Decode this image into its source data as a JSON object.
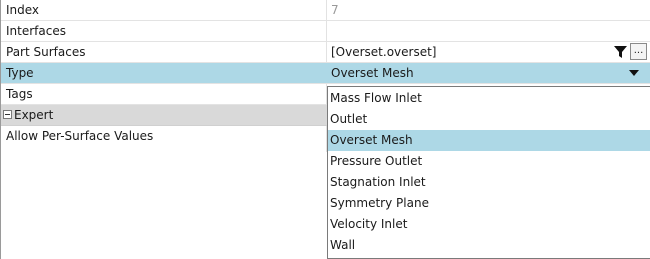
{
  "properties": {
    "index": {
      "label": "Index",
      "value": "7"
    },
    "interfaces": {
      "label": "Interfaces",
      "value": ""
    },
    "part_surfaces": {
      "label": "Part Surfaces",
      "value": "[Overset.overset]",
      "more_label": "..."
    },
    "type": {
      "label": "Type",
      "value": "Overset Mesh"
    },
    "tags": {
      "label": "Tags"
    },
    "expert": {
      "label": "Expert"
    },
    "allow_per_surface": {
      "label": "Allow Per-Surface Values"
    }
  },
  "type_dropdown": {
    "options": [
      "Mass Flow Inlet",
      "Outlet",
      "Overset Mesh",
      "Pressure Outlet",
      "Stagnation Inlet",
      "Symmetry Plane",
      "Velocity Inlet",
      "Wall"
    ],
    "highlighted": "Overset Mesh"
  },
  "colors": {
    "selection": "#add8e6",
    "group_header": "#d9d9d9",
    "muted_value": "#9a9a9a"
  },
  "icons": [
    "filter-icon",
    "minus-box-icon",
    "dropdown-arrow-icon"
  ]
}
